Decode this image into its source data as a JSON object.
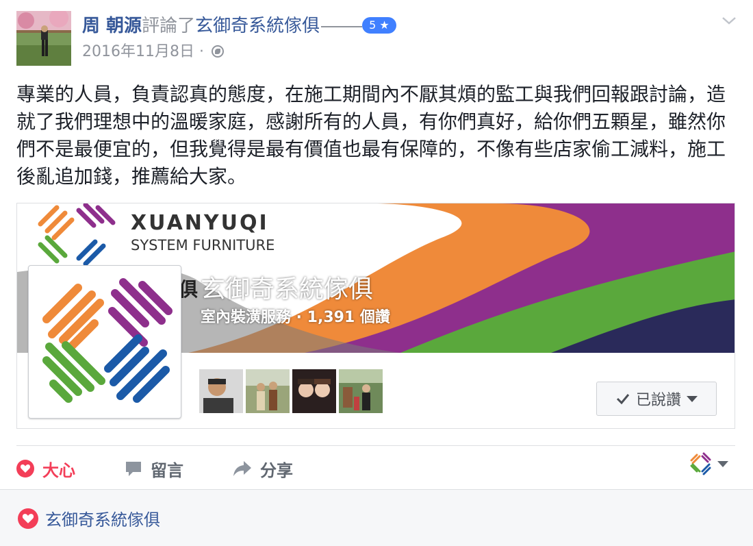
{
  "post": {
    "author": "周 朝源",
    "verb": "評論了",
    "page_name": "玄御奇系統傢俱",
    "rating": "5 ★",
    "date": "2016年11月8日",
    "dot": "·",
    "text": "專業的人員，負責認真的態度，在施工期間內不厭其煩的監工與我們回報跟討論，造就了我們理想中的溫暖家庭，感謝所有的人員，有你們真好，給你們五顆星，雖然你們不是最便宜的，但我覺得是最有價值也最有保障的，不像有些店家偷工減料，施工後亂追加錢，推薦給大家。"
  },
  "card": {
    "brand_line1": "XUANYUQI",
    "brand_line2": "SYSTEM FURNITURE",
    "brand_partial": "俱",
    "page_name": "玄御奇系統傢俱",
    "subtitle": "室內裝潢服務 · 1,391 個讚",
    "liked_label": "已說讚"
  },
  "actions": {
    "love": "大心",
    "comment": "留言",
    "share": "分享"
  },
  "footer": {
    "reactor_name": "玄御奇系統傢俱"
  },
  "colors": {
    "link": "#365899",
    "love": "#f33e58",
    "badge": "#4080ff",
    "brand_orange": "#ef8a3a",
    "brand_purple": "#8e2f8c",
    "brand_green": "#5aa83c",
    "brand_blue": "#1b5aa8"
  },
  "icons": {
    "chevron": "chevron-down-icon",
    "globe": "globe-icon",
    "check": "check-icon",
    "love": "heart-icon",
    "comment": "comment-icon",
    "share": "share-icon"
  }
}
